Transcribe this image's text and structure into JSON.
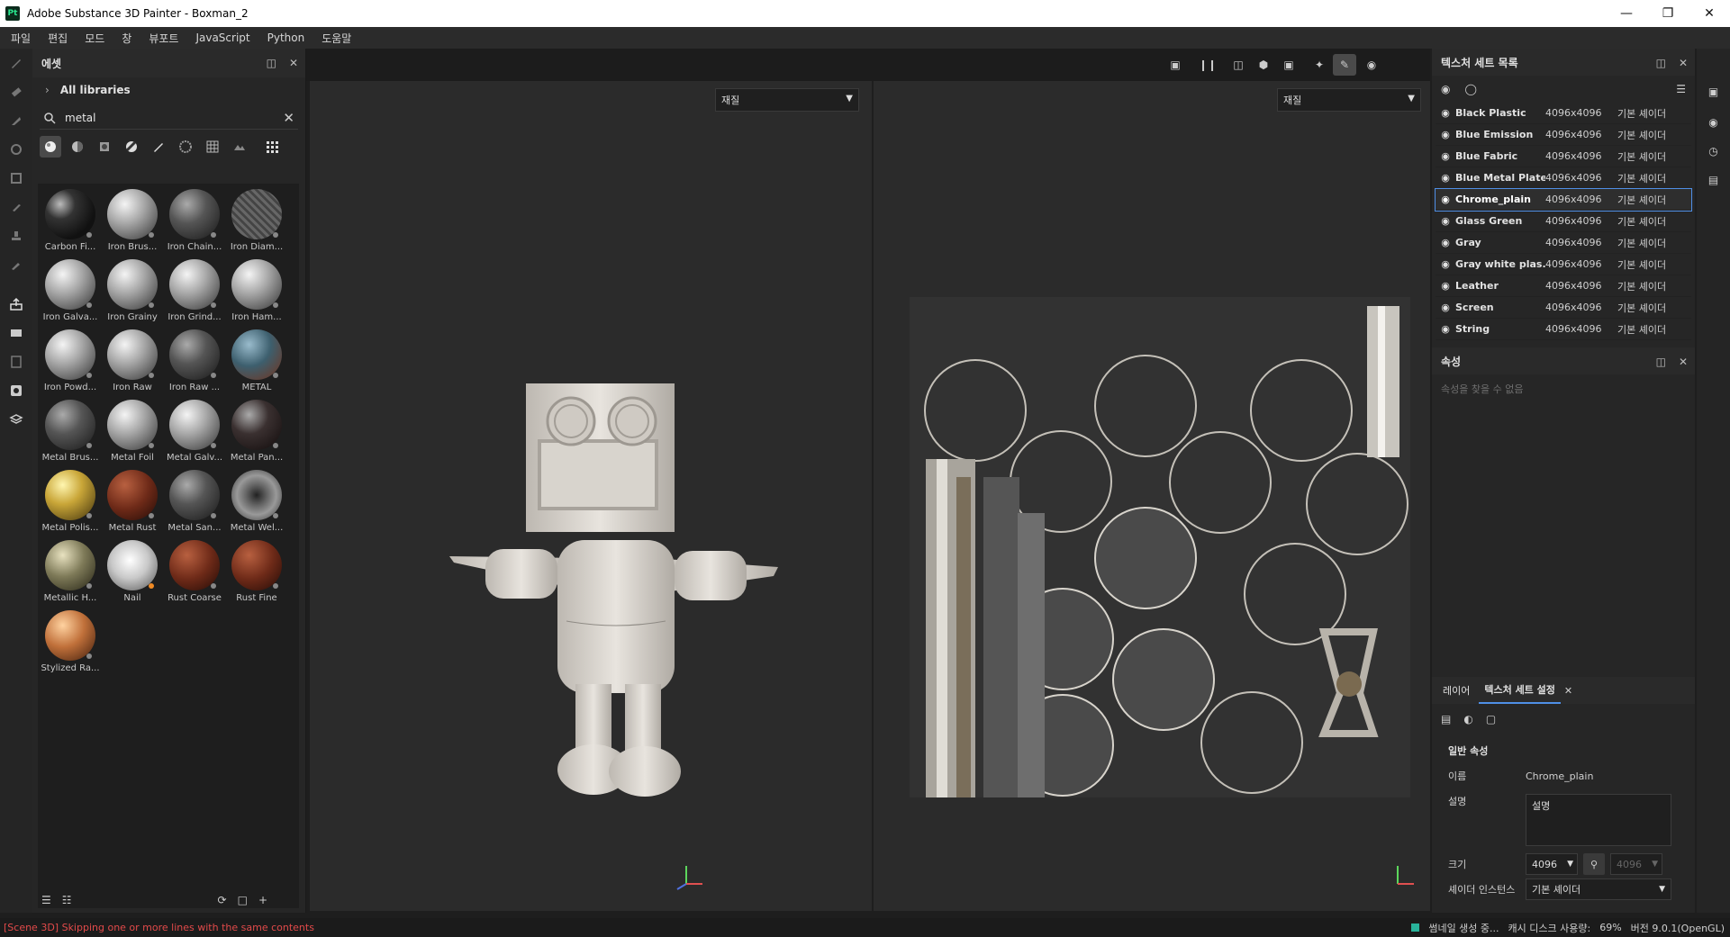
{
  "window": {
    "title": "Adobe Substance 3D Painter - Boxman_2",
    "app_badge": "Pt"
  },
  "menu": [
    "파일",
    "편집",
    "모드",
    "창",
    "뷰포트",
    "JavaScript",
    "Python",
    "도움말"
  ],
  "assets": {
    "panel_title": "에셋",
    "breadcrumb": "All libraries",
    "search_value": "metal",
    "items": [
      {
        "label": "Carbon Fi...",
        "style": "carbon"
      },
      {
        "label": "Iron Brus...",
        "style": "silver"
      },
      {
        "label": "Iron Chain...",
        "style": "dark"
      },
      {
        "label": "Iron Diam...",
        "style": "diamond"
      },
      {
        "label": "Iron Galva...",
        "style": "silver"
      },
      {
        "label": "Iron Grainy",
        "style": "silver"
      },
      {
        "label": "Iron Grind...",
        "style": "silver"
      },
      {
        "label": "Iron Ham...",
        "style": "silver"
      },
      {
        "label": "Iron Powd...",
        "style": "silver"
      },
      {
        "label": "Iron Raw",
        "style": "silver"
      },
      {
        "label": "Iron Raw ...",
        "style": "dark"
      },
      {
        "label": "METAL",
        "style": "blue"
      },
      {
        "label": "Metal Brus...",
        "style": "dark"
      },
      {
        "label": "Metal Foil",
        "style": "silver"
      },
      {
        "label": "Metal Galv...",
        "style": "silver"
      },
      {
        "label": "Metal Pan...",
        "style": "darkred"
      },
      {
        "label": "Metal Polis...",
        "style": "gold"
      },
      {
        "label": "Metal Rust",
        "style": "rust"
      },
      {
        "label": "Metal San...",
        "style": "dark"
      },
      {
        "label": "Metal Wel...",
        "style": "weld"
      },
      {
        "label": "Metallic H...",
        "style": "olive"
      },
      {
        "label": "Nail",
        "style": "nail"
      },
      {
        "label": "Rust Coarse",
        "style": "rust"
      },
      {
        "label": "Rust Fine",
        "style": "rust"
      },
      {
        "label": "Stylized Ra...",
        "style": "copper"
      }
    ]
  },
  "viewport": {
    "left_select": "재질",
    "right_select": "재질"
  },
  "texture_sets": {
    "panel_title": "텍스처 세트 목록",
    "rows": [
      {
        "name": "Black Plastic",
        "res": "4096x4096",
        "shader": "기본 셰이더"
      },
      {
        "name": "Blue Emission",
        "res": "4096x4096",
        "shader": "기본 셰이더"
      },
      {
        "name": "Blue Fabric",
        "res": "4096x4096",
        "shader": "기본 셰이더"
      },
      {
        "name": "Blue Metal Plate",
        "res": "4096x4096",
        "shader": "기본 셰이더"
      },
      {
        "name": "Chrome_plain",
        "res": "4096x4096",
        "shader": "기본 셰이더"
      },
      {
        "name": "Glass Green",
        "res": "4096x4096",
        "shader": "기본 셰이더"
      },
      {
        "name": "Gray",
        "res": "4096x4096",
        "shader": "기본 셰이더"
      },
      {
        "name": "Gray white plas...",
        "res": "4096x4096",
        "shader": "기본 셰이더"
      },
      {
        "name": "Leather",
        "res": "4096x4096",
        "shader": "기본 셰이더"
      },
      {
        "name": "Screen",
        "res": "4096x4096",
        "shader": "기본 셰이더"
      },
      {
        "name": "String",
        "res": "4096x4096",
        "shader": "기본 셰이더"
      }
    ],
    "selected_index": 4
  },
  "properties": {
    "panel_title": "속성",
    "empty_text": "속성을 찾을 수 없음"
  },
  "settings": {
    "tab_layers": "레이어",
    "tab_settings": "텍스처 세트 설정",
    "section": "일반 속성",
    "name_label": "이름",
    "name_value": "Chrome_plain",
    "desc_label": "설명",
    "desc_value": "설명",
    "size_label": "크기",
    "size_value": "4096",
    "size_value2": "4096",
    "shader_label": "셰이더 인스턴스",
    "shader_value": "기본 셰이더"
  },
  "status": {
    "message": "[Scene 3D] Skipping one or more lines with the same contents",
    "thumb_gen": "썸네일 생성 중...",
    "cache": "캐시 디스크 사용량:",
    "cache_pct": "69%",
    "version": "버전 9.0.1(OpenGL)"
  },
  "colors": {
    "accent": "#4f8fe6",
    "error": "#e24a4a",
    "bg": "#1e1e1e",
    "panel": "#262626"
  }
}
